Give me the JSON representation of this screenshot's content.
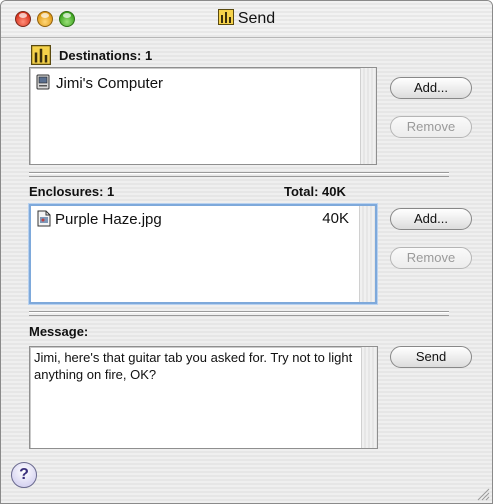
{
  "window": {
    "title": "Send"
  },
  "destinations": {
    "label": "Destinations: 1",
    "items": [
      {
        "name": "Jimi's Computer"
      }
    ],
    "add_label": "Add...",
    "remove_label": "Remove"
  },
  "enclosures": {
    "label": "Enclosures: 1",
    "total": "Total: 40K",
    "items": [
      {
        "name": "Purple Haze.jpg",
        "size": "40K"
      }
    ],
    "add_label": "Add...",
    "remove_label": "Remove"
  },
  "message": {
    "label": "Message:",
    "text": "Jimi, here's that guitar tab you asked for. Try not to light anything on fire, OK?",
    "send_label": "Send"
  },
  "help": {
    "glyph": "?"
  }
}
